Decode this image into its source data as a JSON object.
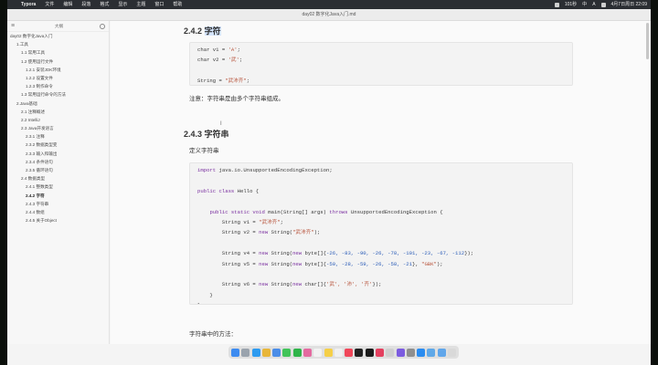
{
  "menubar": {
    "apple_glyph": "",
    "app_name": "Typora",
    "items": [
      "文件",
      "编辑",
      "段落",
      "格式",
      "显示",
      "主题",
      "窗口",
      "帮助"
    ],
    "status": [
      "101秒",
      "中",
      "A"
    ],
    "datetime": "4月7日周日 22:09"
  },
  "window": {
    "title": "day02 数字化Java入门.md"
  },
  "sidebar": {
    "title": "大纲",
    "items": [
      {
        "label": "day02 数字化Java入门",
        "level": 0
      },
      {
        "label": "1.工具",
        "level": 1
      },
      {
        "label": "1.1 常用工具",
        "level": 2
      },
      {
        "label": "1.2 使用运行文件",
        "level": 2
      },
      {
        "label": "1.2.1 安装JDK环境",
        "level": 3
      },
      {
        "label": "1.2.2 设置文件",
        "level": 3
      },
      {
        "label": "1.2.3 制作命令",
        "level": 3
      },
      {
        "label": "1.3 常用运行命令的方法",
        "level": 2
      },
      {
        "label": "2.Java基础",
        "level": 1
      },
      {
        "label": "2.1 注释概述",
        "level": 2
      },
      {
        "label": "2.2 IntelliJ",
        "level": 2
      },
      {
        "label": "2.3 Java开发语言",
        "level": 2
      },
      {
        "label": "2.3.1 注释",
        "level": 3
      },
      {
        "label": "2.3.2 数据类型变",
        "level": 3
      },
      {
        "label": "2.3.3 输入和输出",
        "level": 3
      },
      {
        "label": "2.3.4 条件语句",
        "level": 3
      },
      {
        "label": "2.3.5 循环语句",
        "level": 3
      },
      {
        "label": "2.4 数据类型",
        "level": 2
      },
      {
        "label": "2.4.1 整数类型",
        "level": 3
      },
      {
        "label": "2.4.2 字符",
        "level": 3,
        "active": true
      },
      {
        "label": "2.4.3 字符串",
        "level": 3
      },
      {
        "label": "2.4.4 数组",
        "level": 3
      },
      {
        "label": "2.4.5 关于Object",
        "level": 3
      }
    ]
  },
  "content": {
    "heading_1": "2.4.2 ",
    "heading_1_highlight": "字符",
    "code1": {
      "lines": [
        [
          [
            "char v1 = ",
            ""
          ],
          [
            "'A'",
            "str"
          ],
          [
            ";",
            ""
          ]
        ],
        [
          [
            "char v2 = ",
            ""
          ],
          [
            "'武'",
            "str"
          ],
          [
            ";",
            ""
          ]
        ],
        [
          [
            "",
            ""
          ]
        ],
        [
          [
            "String = ",
            ""
          ],
          [
            "\"武沛齐\"",
            "str"
          ],
          [
            ";",
            ""
          ]
        ]
      ]
    },
    "note": "注意：字符串是由多个字符串组成。",
    "heading_2": "2.4.3 字符串",
    "define_label": "定义字符串",
    "code2": {
      "lines": [
        [
          [
            "import",
            "kw"
          ],
          [
            " java.io.UnsupportedEncodingException;",
            ""
          ]
        ],
        [
          [
            "",
            ""
          ]
        ],
        [
          [
            "public class",
            "kw"
          ],
          [
            " Hello {",
            ""
          ]
        ],
        [
          [
            "",
            ""
          ]
        ],
        [
          [
            "    ",
            ""
          ],
          [
            "public static void",
            "kw"
          ],
          [
            " main(String[] args) ",
            ""
          ],
          [
            "throws",
            "kw"
          ],
          [
            " UnsupportedEncodingException {",
            ""
          ]
        ],
        [
          [
            "        String v1 = ",
            ""
          ],
          [
            "\"武沛齐\"",
            "str"
          ],
          [
            ";",
            ""
          ]
        ],
        [
          [
            "        String v2 = ",
            ""
          ],
          [
            "new",
            "kw"
          ],
          [
            " String(",
            ""
          ],
          [
            "\"武沛齐\"",
            "str"
          ],
          [
            ");",
            ""
          ]
        ],
        [
          [
            "",
            ""
          ]
        ],
        [
          [
            "        String v4 = ",
            ""
          ],
          [
            "new",
            "kw"
          ],
          [
            " String(",
            ""
          ],
          [
            "new",
            "kw"
          ],
          [
            " byte[]{",
            ""
          ],
          [
            "-26, -83, -90, -26, -78, -101, -23, -67, -112",
            "num"
          ],
          [
            "});",
            ""
          ]
        ],
        [
          [
            "        String v5 = ",
            ""
          ],
          [
            "new",
            "kw"
          ],
          [
            " String(",
            ""
          ],
          [
            "new",
            "kw"
          ],
          [
            " byte[]{",
            ""
          ],
          [
            "-50, -28, -59, -26, -58, -21",
            "num"
          ],
          [
            "}, ",
            ""
          ],
          [
            "\"GBK\"",
            "str"
          ],
          [
            ");",
            ""
          ]
        ],
        [
          [
            "",
            ""
          ]
        ],
        [
          [
            "        String v6 = ",
            ""
          ],
          [
            "new",
            "kw"
          ],
          [
            " String(",
            ""
          ],
          [
            "new",
            "kw"
          ],
          [
            " char[]{",
            ""
          ],
          [
            "'武', '沛', '齐'",
            "str"
          ],
          [
            "});",
            ""
          ]
        ],
        [
          [
            "    }",
            ""
          ]
        ],
        [
          [
            "}",
            ""
          ]
        ]
      ]
    },
    "methods_label": "字符串中的方法："
  },
  "dock": {
    "icons": [
      {
        "name": "finder-icon",
        "color": "#3d8bf0"
      },
      {
        "name": "launchpad-icon",
        "color": "#9aa3ad"
      },
      {
        "name": "safari-icon",
        "color": "#2e9bf0"
      },
      {
        "name": "chrome-icon",
        "color": "#e8b63a"
      },
      {
        "name": "mail-icon",
        "color": "#4b8de8"
      },
      {
        "name": "messages-icon",
        "color": "#42c45a"
      },
      {
        "name": "wechat-icon",
        "color": "#2fb44a"
      },
      {
        "name": "photos-icon",
        "color": "#e46aa0"
      },
      {
        "name": "calendar-icon",
        "color": "#f2f2f2"
      },
      {
        "name": "notes-icon",
        "color": "#f5cf48"
      },
      {
        "name": "reminders-icon",
        "color": "#f0f0f0"
      },
      {
        "name": "music-icon",
        "color": "#f0475a"
      },
      {
        "name": "terminal-icon",
        "color": "#222222"
      },
      {
        "name": "pycharm-icon",
        "color": "#1b1b1b"
      },
      {
        "name": "idea-icon",
        "color": "#e4405f"
      },
      {
        "name": "typora-icon",
        "color": "#cfcfcf"
      },
      {
        "name": "preview-icon",
        "color": "#7c5ce0"
      },
      {
        "name": "settings-icon",
        "color": "#8f8f8f"
      },
      {
        "name": "appstore-icon",
        "color": "#2a8cf0"
      },
      {
        "name": "folder-icon",
        "color": "#5fa8e8"
      },
      {
        "name": "downloads-icon",
        "color": "#60a6ea"
      },
      {
        "name": "trash-icon",
        "color": "#d9d9d9"
      }
    ]
  }
}
